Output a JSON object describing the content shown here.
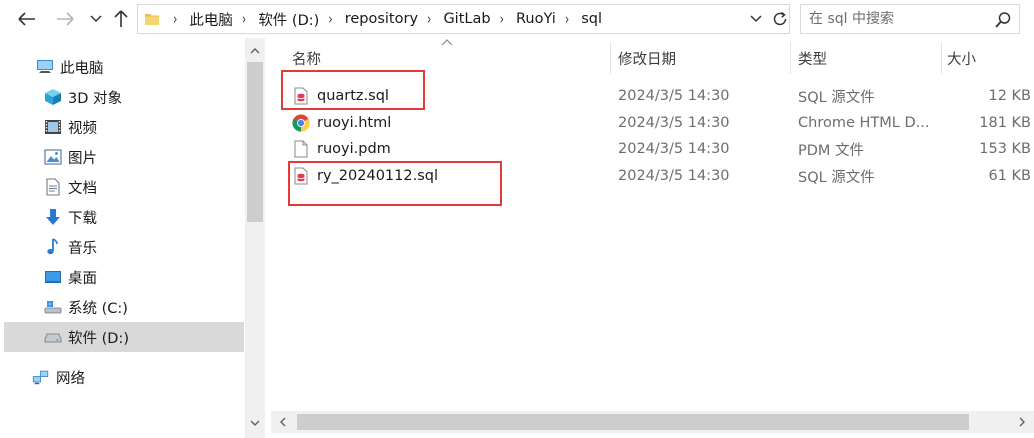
{
  "address": {
    "breadcrumbs": [
      "此电脑",
      "软件 (D:)",
      "repository",
      "GitLab",
      "RuoYi",
      "sql"
    ],
    "separator": "›"
  },
  "search": {
    "placeholder": "在 sql 中搜索",
    "value": ""
  },
  "nav": {
    "items": [
      {
        "label": "此电脑",
        "icon": "computer-icon"
      },
      {
        "label": "3D 对象",
        "icon": "3d-objects-icon"
      },
      {
        "label": "视频",
        "icon": "video-icon"
      },
      {
        "label": "图片",
        "icon": "pictures-icon"
      },
      {
        "label": "文档",
        "icon": "documents-icon"
      },
      {
        "label": "下载",
        "icon": "download-icon"
      },
      {
        "label": "音乐",
        "icon": "music-icon"
      },
      {
        "label": "桌面",
        "icon": "desktop-icon"
      },
      {
        "label": "系统 (C:)",
        "icon": "system-drive-icon"
      },
      {
        "label": "软件 (D:)",
        "icon": "drive-icon",
        "selected": true
      },
      {
        "label": "网络",
        "icon": "network-icon"
      }
    ]
  },
  "columns": {
    "name": "名称",
    "modified": "修改日期",
    "type": "类型",
    "size": "大小"
  },
  "files": [
    {
      "name": "quartz.sql",
      "modified": "2024/3/5 14:30",
      "type": "SQL 源文件",
      "size": "12 KB",
      "icon": "sql-file-icon",
      "highlighted": true
    },
    {
      "name": "ruoyi.html",
      "modified": "2024/3/5 14:30",
      "type": "Chrome HTML D...",
      "size": "181 KB",
      "icon": "chrome-icon",
      "highlighted": false
    },
    {
      "name": "ruoyi.pdm",
      "modified": "2024/3/5 14:30",
      "type": "PDM 文件",
      "size": "153 KB",
      "icon": "blank-file-icon",
      "highlighted": false
    },
    {
      "name": "ry_20240112.sql",
      "modified": "2024/3/5 14:30",
      "type": "SQL 源文件",
      "size": "61 KB",
      "icon": "sql-file-icon",
      "highlighted": true
    }
  ],
  "colors": {
    "highlight_box": "#e53935",
    "selected_bg": "#d9d9d9",
    "folder": "#e8c04b"
  }
}
